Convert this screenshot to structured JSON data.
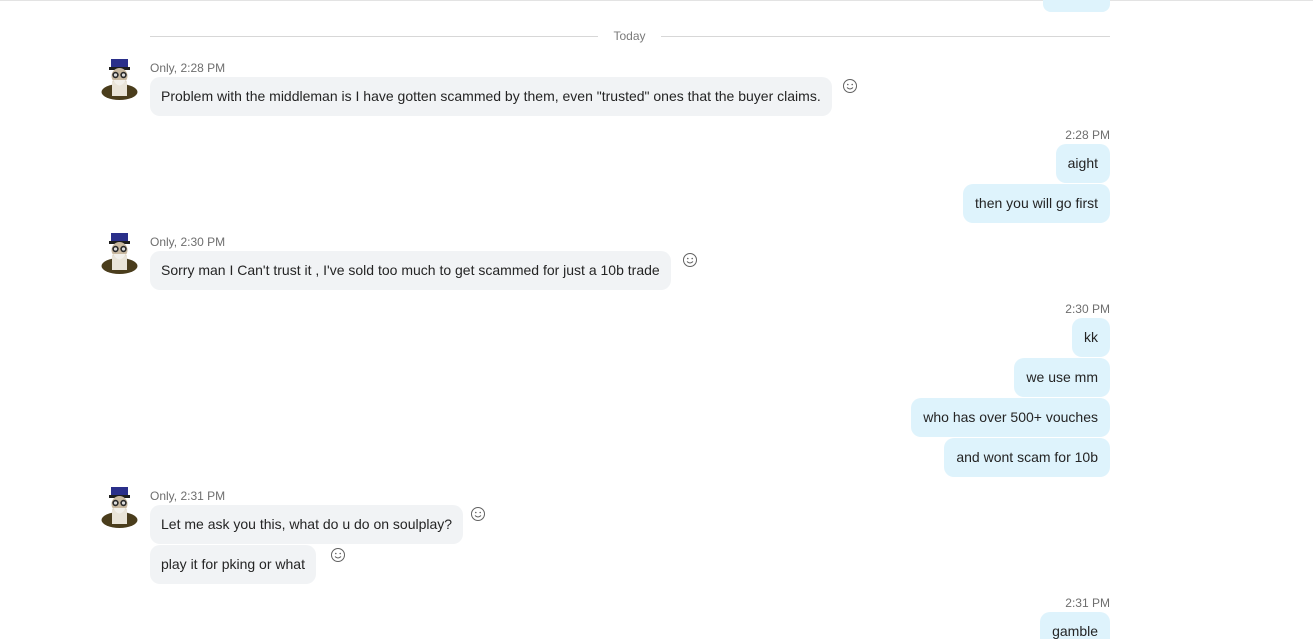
{
  "divider": {
    "label": "Today"
  },
  "colors": {
    "incoming_bubble": "#f1f3f5",
    "outgoing_bubble": "#def3fc",
    "meta_text": "#6e6e6e"
  },
  "messages": [
    {
      "kind": "incoming-meta",
      "text": "Only, 2:28 PM"
    },
    {
      "kind": "incoming",
      "text": "Problem with the middleman is I have gotten scammed by them, even \"trusted\" ones that the buyer claims."
    },
    {
      "kind": "outgoing-meta",
      "text": "2:28 PM"
    },
    {
      "kind": "outgoing",
      "text": "aight"
    },
    {
      "kind": "outgoing",
      "text": "then you will go first"
    },
    {
      "kind": "incoming-meta",
      "text": "Only, 2:30 PM"
    },
    {
      "kind": "incoming",
      "text": "Sorry man I Can't trust it , I've sold too much to get scammed for just a 10b trade"
    },
    {
      "kind": "outgoing-meta",
      "text": "2:30 PM"
    },
    {
      "kind": "outgoing",
      "text": "kk"
    },
    {
      "kind": "outgoing",
      "text": "we use mm"
    },
    {
      "kind": "outgoing",
      "text": "who has over 500+ vouches"
    },
    {
      "kind": "outgoing",
      "text": "and wont scam for 10b"
    },
    {
      "kind": "incoming-meta",
      "text": "Only, 2:31 PM"
    },
    {
      "kind": "incoming",
      "text": "Let me ask you this, what do u do on soulplay?"
    },
    {
      "kind": "incoming",
      "text": "play it for pking or what"
    },
    {
      "kind": "outgoing-meta",
      "text": "2:31 PM"
    },
    {
      "kind": "outgoing",
      "text": "gamble"
    }
  ],
  "icons": {
    "avatar": "contact-avatar-icon",
    "reaction": "smiley-reaction-icon"
  }
}
